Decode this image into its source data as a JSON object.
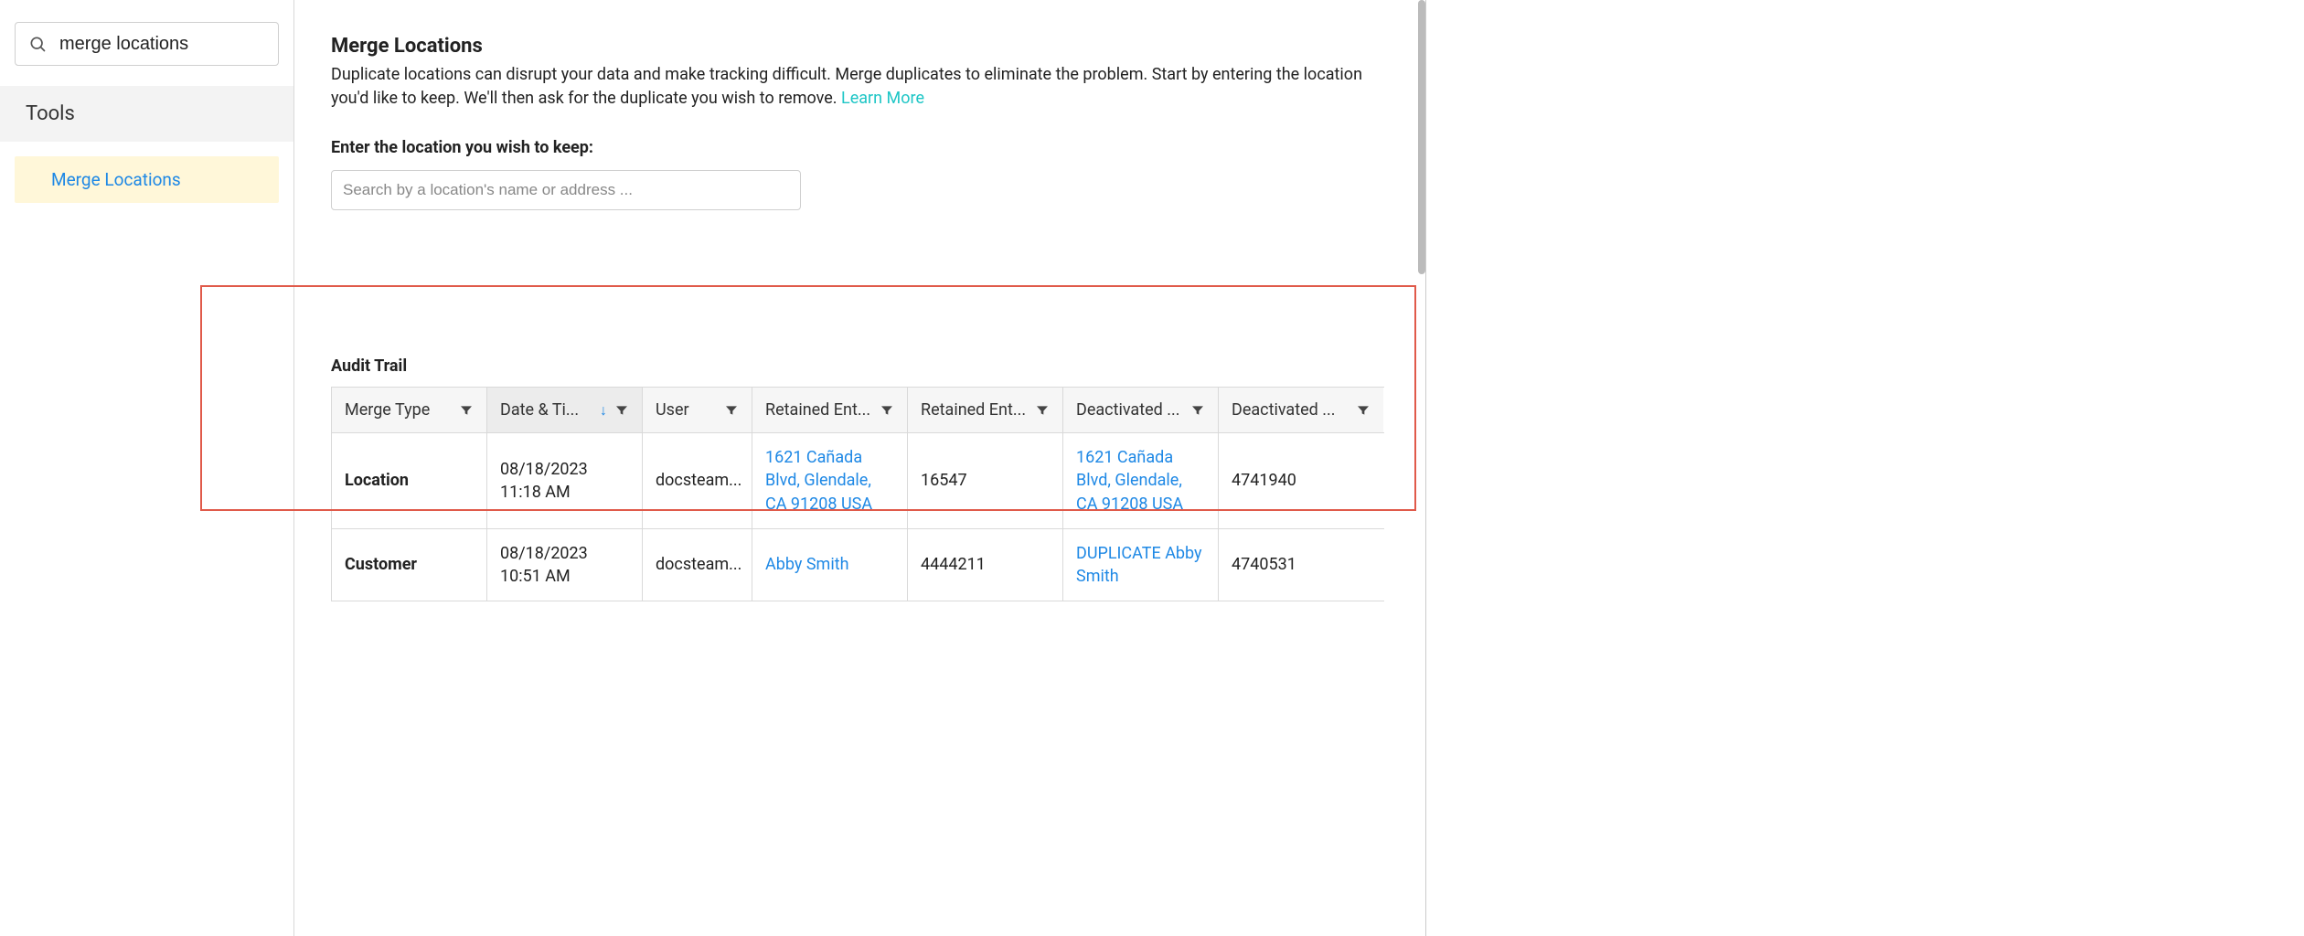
{
  "sidebar": {
    "search_value": "merge locations",
    "section_label": "Tools",
    "active_item": "Merge Locations"
  },
  "page": {
    "title": "Merge Locations",
    "description_prefix": "Duplicate locations can disrupt your data and make tracking difficult. Merge duplicates to eliminate the problem. Start by entering the location you'd like to keep. We'll then ask for the duplicate you wish to remove. ",
    "learn_more": "Learn More",
    "field_label": "Enter the location you wish to keep:",
    "input_placeholder": "Search by a location's name or address ..."
  },
  "audit": {
    "title": "Audit Trail",
    "columns": [
      "Merge Type",
      "Date & Ti...",
      "User",
      "Retained Ent...",
      "Retained Ent...",
      "Deactivated ...",
      "Deactivated ..."
    ],
    "sorted_column_index": 1,
    "rows": [
      {
        "merge_type": "Location",
        "datetime": "08/18/2023 11:18 AM",
        "user": "docsteam...",
        "retained_entity_link": "1621 Cañada Blvd, Glendale, CA 91208 USA",
        "retained_id": "16547",
        "deactivated_entity_link": "1621 Cañada Blvd, Glendale, CA 91208 USA",
        "deactivated_id": "4741940"
      },
      {
        "merge_type": "Customer",
        "datetime": "08/18/2023 10:51 AM",
        "user": "docsteam...",
        "retained_entity_link": "Abby Smith",
        "retained_id": "4444211",
        "deactivated_entity_link": "DUPLICATE Abby Smith",
        "deactivated_id": "4740531"
      }
    ]
  }
}
